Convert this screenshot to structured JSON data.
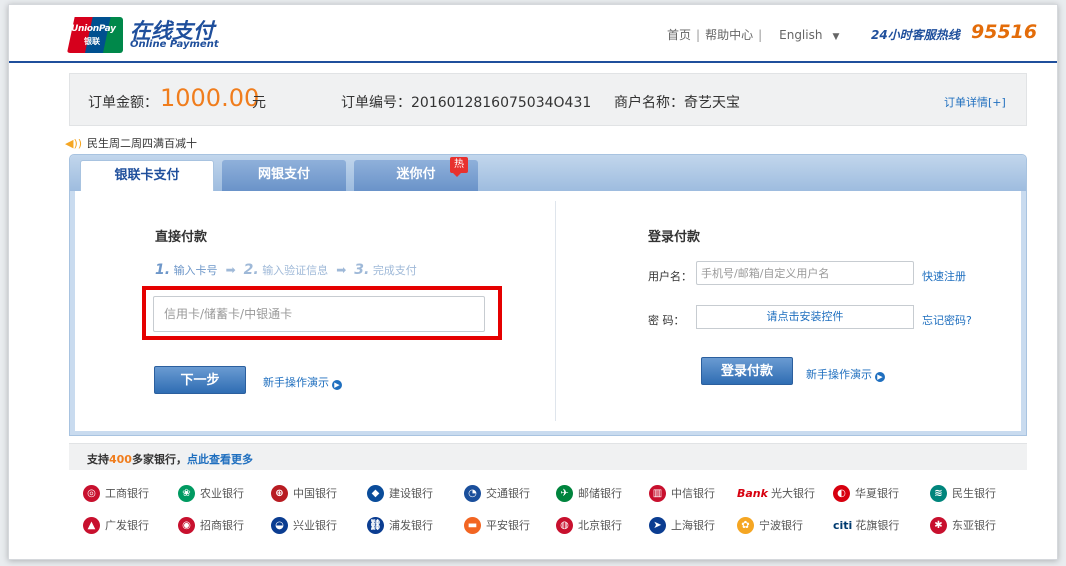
{
  "header": {
    "logo_badge_line1": "UnionPay",
    "logo_badge_line2": "银联",
    "logo_title": "在线支付",
    "logo_subtitle": "Online Payment",
    "nav": [
      "首页",
      "帮助中心",
      "English"
    ],
    "hotline_label": "24小时客服热线",
    "hotline_number": "95516"
  },
  "order": {
    "amount_label": "订单金额：",
    "amount_value": "1000.00",
    "amount_unit": "元",
    "order_no": "订单编号：2016012816075034O431",
    "merchant": "商户名称：奇艺天宝",
    "detail_link": "订单详情[+]"
  },
  "promo": "民生周二周四满百减十",
  "tabs": [
    "银联卡支付",
    "网银支付",
    "迷你付"
  ],
  "hot_badge": "热",
  "direct_pay": {
    "title": "直接付款",
    "steps": [
      {
        "num": "1.",
        "label": "输入卡号"
      },
      {
        "num": "2.",
        "label": "输入验证信息"
      },
      {
        "num": "3.",
        "label": "完成支付"
      }
    ],
    "card_placeholder": "信用卡/储蓄卡/中银通卡",
    "next_button": "下一步",
    "demo_link": "新手操作演示"
  },
  "login_pay": {
    "title": "登录付款",
    "username_label": "用户名：",
    "username_placeholder": "手机号/邮箱/自定义用户名",
    "quick_register": "快速注册",
    "password_label": "密  码：",
    "password_control": "请点击安装控件",
    "forgot_password": "忘记密码?",
    "login_button": "登录付款",
    "demo_link": "新手操作演示"
  },
  "banks_bar": {
    "prefix": "支持",
    "count": "400",
    "suffix": "多家银行，",
    "more_link": "点此查看更多"
  },
  "banks": [
    {
      "name": "工商银行",
      "icon": "icbc-icon",
      "color": "#c8102e"
    },
    {
      "name": "农业银行",
      "icon": "abc-icon",
      "color": "#009a61"
    },
    {
      "name": "中国银行",
      "icon": "boc-icon",
      "color": "#b81c22"
    },
    {
      "name": "建设银行",
      "icon": "ccb-icon",
      "color": "#0a4c9a"
    },
    {
      "name": "交通银行",
      "icon": "bocom-icon",
      "color": "#1a4f9c"
    },
    {
      "name": "邮储银行",
      "icon": "psbc-icon",
      "color": "#00843d"
    },
    {
      "name": "中信银行",
      "icon": "citic-icon",
      "color": "#c8102e"
    },
    {
      "name": "光大银行",
      "icon": "ceb-icon",
      "color": "#6b2c91"
    },
    {
      "name": "华夏银行",
      "icon": "hxb-icon",
      "color": "#d7000f"
    },
    {
      "name": "民生银行",
      "icon": "cmbc-icon",
      "color": "#00857c"
    },
    {
      "name": "广发银行",
      "icon": "cgb-icon",
      "color": "#c8102e"
    },
    {
      "name": "招商银行",
      "icon": "cmb-icon",
      "color": "#c8102e"
    },
    {
      "name": "兴业银行",
      "icon": "cib-icon",
      "color": "#0b3d91"
    },
    {
      "name": "浦发银行",
      "icon": "spdb-icon",
      "color": "#0b3d91"
    },
    {
      "name": "平安银行",
      "icon": "pingan-icon",
      "color": "#f26522"
    },
    {
      "name": "北京银行",
      "icon": "bob-icon",
      "color": "#c8102e"
    },
    {
      "name": "上海银行",
      "icon": "bosc-icon",
      "color": "#0b3d91"
    },
    {
      "name": "宁波银行",
      "icon": "nbcb-icon",
      "color": "#f5a623"
    },
    {
      "name": "花旗银行",
      "icon": "citi-icon",
      "color": "#003b70"
    },
    {
      "name": "东亚银行",
      "icon": "bea-icon",
      "color": "#c8102e"
    }
  ],
  "bank_icon_glyphs": {
    "ceb": "Bank",
    "citi": "citi"
  }
}
